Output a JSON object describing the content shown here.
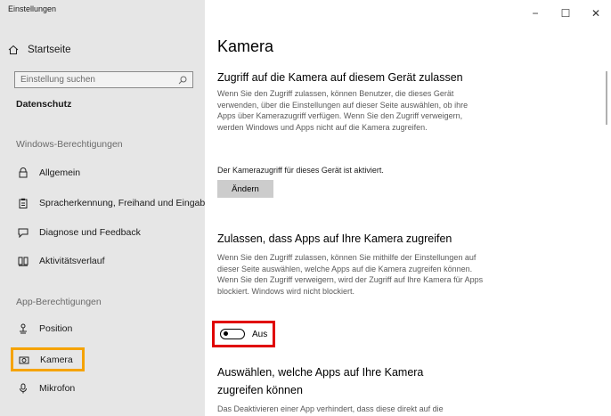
{
  "window": {
    "title": "Einstellungen",
    "controls": [
      "−",
      "☐",
      "✕"
    ]
  },
  "sidebar": {
    "home_label": "Startseite",
    "search_placeholder": "Einstellung suchen",
    "section_title": "Datenschutz",
    "group_windows": "Windows-Berechtigungen",
    "group_app": "App-Berechtigungen",
    "items": [
      {
        "label": "Allgemein",
        "icon": "lock-icon"
      },
      {
        "label": "Spracherkennung, Freihand und Eingabe",
        "icon": "clipboard-icon"
      },
      {
        "label": "Diagnose und Feedback",
        "icon": "feedback-icon"
      },
      {
        "label": "Aktivitätsverlauf",
        "icon": "timeline-icon"
      },
      {
        "label": "Position",
        "icon": "location-icon"
      },
      {
        "label": "Kamera",
        "icon": "camera-icon",
        "selected": true
      },
      {
        "label": "Mikrofon",
        "icon": "microphone-icon"
      }
    ]
  },
  "content": {
    "title": "Kamera",
    "section1": {
      "heading": "Zugriff auf die Kamera auf diesem Gerät zulassen",
      "text": "Wenn Sie den Zugriff zulassen, können Benutzer, die dieses Gerät verwenden, über die Einstellungen auf dieser Seite auswählen, ob ihre Apps über Kamerazugriff verfügen. Wenn Sie den Zugriff verweigern, werden Windows und Apps nicht auf die Kamera zugreifen.",
      "status": "Der Kamerazugriff für dieses Gerät ist aktiviert.",
      "button": "Ändern"
    },
    "section2": {
      "heading": "Zulassen, dass Apps auf Ihre Kamera zugreifen",
      "text": "Wenn Sie den Zugriff zulassen, können Sie mithilfe der Einstellungen auf dieser Seite auswählen, welche Apps auf die Kamera zugreifen können. Wenn Sie den Zugriff verweigern, wird der Zugriff auf Ihre Kamera für Apps blockiert. Windows wird nicht blockiert.",
      "toggle_label": "Aus",
      "toggle_on": false
    },
    "section3": {
      "heading_line1": "Auswählen, welche Apps auf Ihre Kamera",
      "heading_line2": "zugreifen können",
      "text": "Das Deaktivieren einer App verhindert, dass diese direkt auf die"
    }
  },
  "colors": {
    "highlight_orange": "#f5a300",
    "highlight_red": "#e00000",
    "sidebar_bg": "#e6e6e6"
  }
}
